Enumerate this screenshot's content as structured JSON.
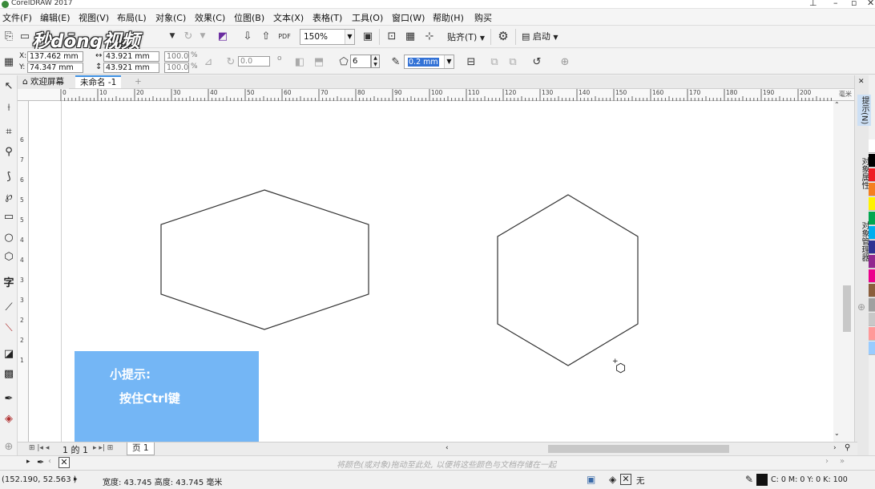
{
  "app": {
    "title": "CorelDRAW 2017"
  },
  "menu": [
    "文件(F)",
    "编辑(E)",
    "视图(V)",
    "布局(L)",
    "对象(C)",
    "效果(C)",
    "位图(B)",
    "文本(X)",
    "表格(T)",
    "工具(O)",
    "窗口(W)",
    "帮助(H)",
    "购买"
  ],
  "watermark": "秒dōng视频",
  "toolbar": {
    "zoom": "150%",
    "snap_label": "贴齐(T)",
    "launch_label": "启动"
  },
  "property_bar": {
    "x_label": "X:",
    "x_value": "137.462 mm",
    "y_label": "Y:",
    "y_value": "74.347 mm",
    "w_value": "43.921 mm",
    "h_value": "43.921 mm",
    "scale_x": "100.0",
    "scale_y": "100.0",
    "pct": "%",
    "rotation": "0.0",
    "sides": "6",
    "outline_width": "0.2 mm"
  },
  "tabs": {
    "welcome": "欢迎屏幕",
    "doc": "未命名 -1"
  },
  "ruler_h": [
    "0",
    "10",
    "20",
    "30",
    "40",
    "50",
    "60",
    "70",
    "80",
    "90",
    "100",
    "110",
    "120",
    "130",
    "140",
    "150",
    "160",
    "170",
    "180",
    "190",
    "200"
  ],
  "ruler_unit": "毫米",
  "ruler_v": [
    "6",
    "7",
    "6",
    "5",
    "5",
    "4",
    "4",
    "3",
    "3",
    "2",
    "2",
    "1"
  ],
  "hint": {
    "line1": "小提示:",
    "line2": "按住Ctrl键"
  },
  "page_nav": {
    "current": "1",
    "of": "的",
    "total": "1",
    "page_tab": "页 1"
  },
  "colorbar": {
    "hint_text": "将颜色(或对象)拖动至此处, 以便将这些颜色与文档存储在一起"
  },
  "status": {
    "coords": "(152.190, 52.563 )",
    "size": "宽度: 43.745  高度: 43.745  毫米",
    "fill_label": "无",
    "outline_color": "C: 0 M: 0 Y: 0 K: 100"
  },
  "docker": {
    "hints": "提示(N)",
    "props": "对象属性",
    "manager": "对象管理器"
  },
  "colors": {
    "hint_bg": "#74b6f5",
    "outline": "#000000"
  },
  "palette": [
    "#ffffff",
    "#000000",
    "#ee1d24",
    "#f57f20",
    "#fff200",
    "#00a650",
    "#00aeef",
    "#2e3192",
    "#92278f",
    "#ec008c",
    "#8b5e3c",
    "#a0a0a0",
    "#c8c8c8",
    "#ff9999",
    "#99ccff"
  ]
}
